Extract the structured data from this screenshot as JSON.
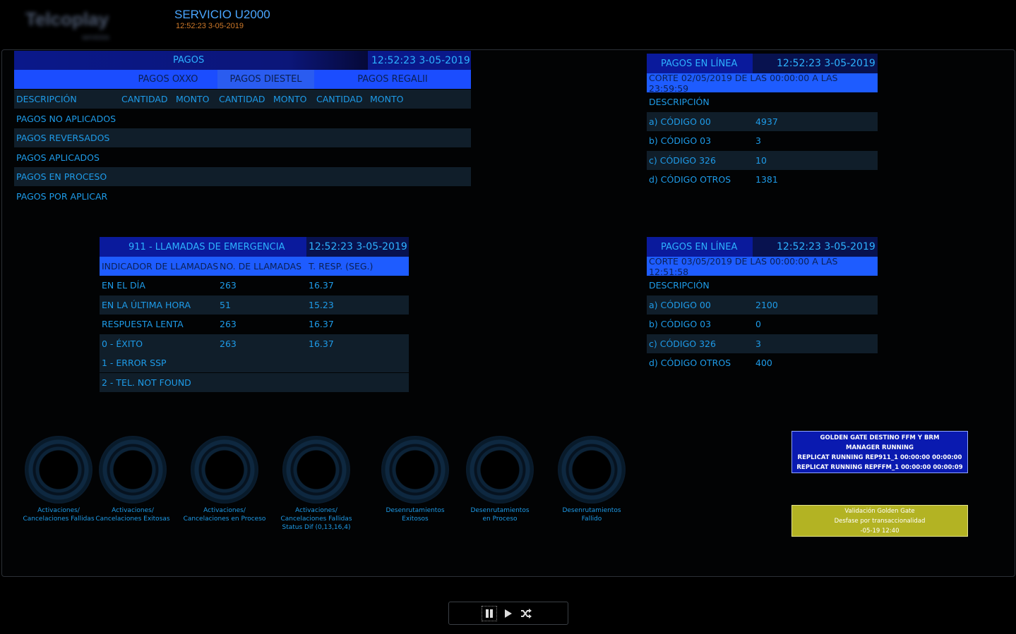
{
  "header": {
    "logo_text": "Telcoplay",
    "logo_subtext": "servicios",
    "title": "SERVICIO U2000",
    "timestamp": "12:52:23 3-05-2019"
  },
  "pagos": {
    "title": "PAGOS",
    "timestamp": "12:52:23 3-05-2019",
    "groups": [
      "PAGOS OXXO",
      "PAGOS DIESTEL",
      "PAGOS REGALII"
    ],
    "columns": [
      "DESCRIPCIÓN",
      "CANTIDAD",
      "MONTO",
      "CANTIDAD",
      "MONTO",
      "CANTIDAD",
      "MONTO"
    ],
    "rows": [
      "PAGOS NO APLICADOS",
      "PAGOS REVERSADOS",
      "PAGOS APLICADOS",
      "PAGOS EN PROCESO",
      "PAGOS POR APLICAR"
    ]
  },
  "pagos_linea_1": {
    "title": "PAGOS EN LÍNEA",
    "timestamp": "12:52:23 3-05-2019",
    "corte": "CORTE 02/05/2019 DE LAS 00:00:00 A LAS 23:59:59",
    "desc_header": "DESCRIPCIÓN",
    "rows": [
      {
        "label": "a) CÓDIGO 00",
        "value": "4937"
      },
      {
        "label": "b) CÓDIGO 03",
        "value": "3"
      },
      {
        "label": "c) CÓDIGO 326",
        "value": "10"
      },
      {
        "label": "d) CÓDIGO OTROS",
        "value": "1381"
      }
    ]
  },
  "pagos_linea_2": {
    "title": "PAGOS EN LÍNEA",
    "timestamp": "12:52:23 3-05-2019",
    "corte": "CORTE 03/05/2019 DE LAS 00:00:00 A LAS 12:51:58",
    "desc_header": "DESCRIPCIÓN",
    "rows": [
      {
        "label": "a) CÓDIGO 00",
        "value": "2100"
      },
      {
        "label": "b) CÓDIGO 03",
        "value": "0"
      },
      {
        "label": "c) CÓDIGO 326",
        "value": "3"
      },
      {
        "label": "d) CÓDIGO OTROS",
        "value": "400"
      }
    ]
  },
  "emergencias": {
    "title": "911 - LLAMADAS DE EMERGENCIA",
    "timestamp": "12:52:23 3-05-2019",
    "columns": [
      "INDICADOR DE LLAMADAS",
      "NO. DE LLAMADAS",
      "T. RESP. (SEG.)"
    ],
    "rows": [
      {
        "label": "EN EL DÍA",
        "calls": "263",
        "resp": "16.37"
      },
      {
        "label": "EN LA ÚLTIMA HORA",
        "calls": "51",
        "resp": "15.23"
      },
      {
        "label": "RESPUESTA LENTA",
        "calls": "263",
        "resp": "16.37"
      },
      {
        "label": "0 - ÉXITO",
        "calls": "263",
        "resp": "16.37"
      },
      {
        "label": "1 - ERROR SSP",
        "calls": "",
        "resp": ""
      },
      {
        "label": "2 - TEL. NOT FOUND",
        "calls": "",
        "resp": ""
      }
    ]
  },
  "gauges": [
    {
      "line1": "Activaciones/",
      "line2": "Cancelaciones Fallidas",
      "line3": ""
    },
    {
      "line1": "Activaciones/",
      "line2": "Cancelaciones Exitosas",
      "line3": ""
    },
    {
      "line1": "Activaciones/",
      "line2": "Cancelaciones en Proceso",
      "line3": ""
    },
    {
      "line1": "Activaciones/",
      "line2": "Cancelaciones Fallidas",
      "line3": "Status Dif (0,13,16,4)"
    },
    {
      "line1": "Desenrutamientos",
      "line2": "Exitosos",
      "line3": ""
    },
    {
      "line1": "Desenrutamientos",
      "line2": "en Proceso",
      "line3": ""
    },
    {
      "line1": "Desenrutamientos",
      "line2": "Fallido",
      "line3": ""
    }
  ],
  "golden_gate": {
    "lines": [
      "GOLDEN GATE DESTINO FFM Y BRM",
      "MANAGER RUNNING",
      "REPLICAT RUNNING REP911_1 00:00:00 00:00:00",
      "REPLICAT RUNNING REPFFM_1 00:00:00 00:00:09"
    ]
  },
  "validacion": {
    "lines": [
      "Validación Golden Gate",
      "Desfase por transaccionalidad",
      "-05-19 12:40"
    ]
  },
  "player": {
    "pause": "pause-icon",
    "play": "play-icon",
    "shuffle": "shuffle-icon"
  },
  "colors": {
    "dark_header": "#0a1a9c",
    "bright_header": "#1e5cff",
    "text": "#1e9be8",
    "alt_row": "#101e2a",
    "golden_gate": "#0a1ab0",
    "validation": "#b3b323"
  }
}
